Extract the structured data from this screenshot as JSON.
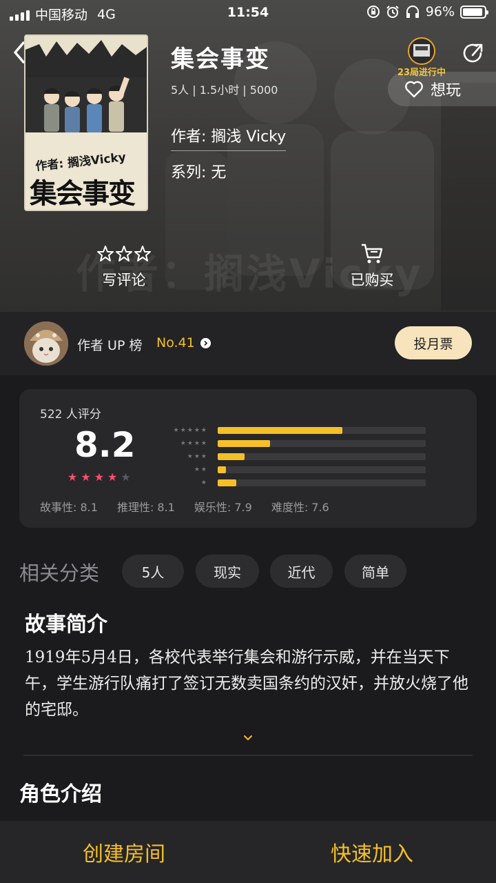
{
  "status_bar": {
    "carrier": "中国移动",
    "network": "4G",
    "time": "11:54",
    "battery": "96%"
  },
  "game": {
    "title": "集会事变",
    "meta": "5人 | 1.5小时 | 5000",
    "author": "作者: 搁浅 Vicky",
    "series": "系列: 无",
    "cover_author": "作者: 搁浅Vicky",
    "cover_title": "集会事变",
    "watermark": "作者：搁浅Vicky"
  },
  "live": {
    "text": "23局进行中"
  },
  "want_label": "想玩",
  "actions": {
    "review_label": "写评论",
    "bought_label": "已购买"
  },
  "up": {
    "label": "作者 UP 榜",
    "rank": "No.41",
    "vote_label": "投月票"
  },
  "rating": {
    "count": "522 人评分",
    "score": "8.2",
    "stars_filled": 4,
    "stars_total": 5,
    "distribution": [
      {
        "stars": "★★★★★",
        "fraction": 0.6
      },
      {
        "stars": "★★★★",
        "fraction": 0.25
      },
      {
        "stars": "★★★",
        "fraction": 0.13
      },
      {
        "stars": "★★",
        "fraction": 0.04
      },
      {
        "stars": "★",
        "fraction": 0.09
      }
    ],
    "subscores": [
      {
        "name": "故事性:",
        "value": "8.1"
      },
      {
        "name": "推理性:",
        "value": "8.1"
      },
      {
        "name": "娱乐性:",
        "value": "7.9"
      },
      {
        "name": "难度性:",
        "value": "7.6"
      }
    ]
  },
  "categories": {
    "title": "相关分类",
    "tags": [
      "5人",
      "现实",
      "近代",
      "简单"
    ]
  },
  "story": {
    "title": "故事简介",
    "body": "1919年5月4日，各校代表举行集会和游行示威，并在当天下午，学生游行队痛打了签订无数卖国条约的汉奸，并放火烧了他的宅邸。"
  },
  "roles": {
    "title": "角色介绍"
  },
  "bottom": {
    "create_label": "创建房间",
    "join_label": "快速加入"
  },
  "colors": {
    "accent": "#f5c027",
    "background": "#1b1b1d",
    "card": "#28282b",
    "star_pink": "#ff4d6d",
    "vote_button": "#f7e4bd"
  }
}
